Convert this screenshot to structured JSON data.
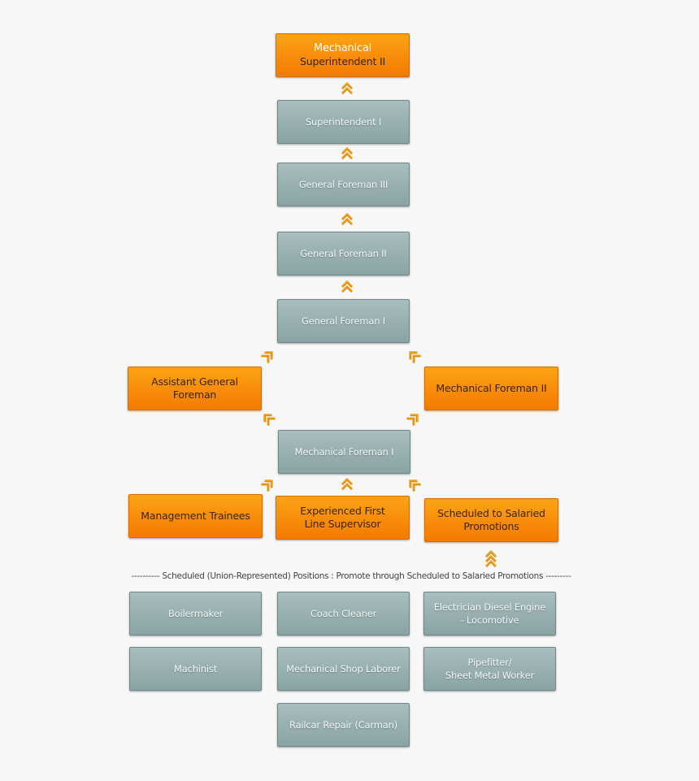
{
  "diagram": {
    "type": "career-ladder",
    "colors": {
      "salaried_highlight": "#f88c0a",
      "position": "#97afaf",
      "arrow": "#f0a020",
      "background": "#f7f7f7"
    },
    "nodes": {
      "mech_superintendent_2": {
        "line1": "Mechanical",
        "line2": "Superintendent II"
      },
      "superintendent_1": "Superintendent  I",
      "general_foreman_3": "General Foreman III",
      "general_foreman_2": "General Foreman II",
      "general_foreman_1": "General Foreman I",
      "assistant_general_foreman": "Assistant General\nForeman",
      "mechanical_foreman_2": "Mechanical Foreman II",
      "mechanical_foreman_1": "Mechanical Foreman I",
      "management_trainees": "Management Trainees",
      "experienced_first_line_supervisor": "Experienced First\nLine Supervisor",
      "scheduled_to_salaried": "Scheduled to Salaried\nPromotions"
    },
    "divider_text": "---------- Scheduled (Union-Represented) Positions : Promote through Scheduled to Salaried Promotions ---------",
    "scheduled_positions": [
      "Boilermaker",
      "Coach Cleaner",
      "Electrician Diesel Engine\n- Locomotive",
      "Machinist",
      "Mechanical Shop Laborer",
      "Pipefitter/\nSheet Metal Worker",
      "Railcar Repair (Carman)"
    ],
    "arrows": [
      {
        "from": "superintendent_1",
        "to": "mech_superintendent_2",
        "icon": "double-chevron-up-icon"
      },
      {
        "from": "general_foreman_3",
        "to": "superintendent_1",
        "icon": "double-chevron-up-icon"
      },
      {
        "from": "general_foreman_2",
        "to": "general_foreman_3",
        "icon": "double-chevron-up-icon"
      },
      {
        "from": "general_foreman_1",
        "to": "general_foreman_2",
        "icon": "double-chevron-up-icon"
      },
      {
        "from": "assistant_general_foreman",
        "to": "general_foreman_1",
        "icon": "double-chevron-up-right-icon"
      },
      {
        "from": "mechanical_foreman_2",
        "to": "general_foreman_1",
        "icon": "double-chevron-up-left-icon"
      },
      {
        "from": "mechanical_foreman_1",
        "to": "assistant_general_foreman",
        "icon": "double-chevron-up-left-icon"
      },
      {
        "from": "mechanical_foreman_1",
        "to": "mechanical_foreman_2",
        "icon": "double-chevron-up-right-icon"
      },
      {
        "from": "management_trainees",
        "to": "mechanical_foreman_1",
        "icon": "double-chevron-up-right-icon"
      },
      {
        "from": "experienced_first_line_supervisor",
        "to": "mechanical_foreman_1",
        "icon": "double-chevron-up-icon"
      },
      {
        "from": "scheduled_to_salaried",
        "to": "mechanical_foreman_1",
        "icon": "double-chevron-up-left-icon"
      },
      {
        "from": "scheduled_positions",
        "to": "scheduled_to_salaried",
        "icon": "triple-chevron-up-icon"
      }
    ]
  }
}
